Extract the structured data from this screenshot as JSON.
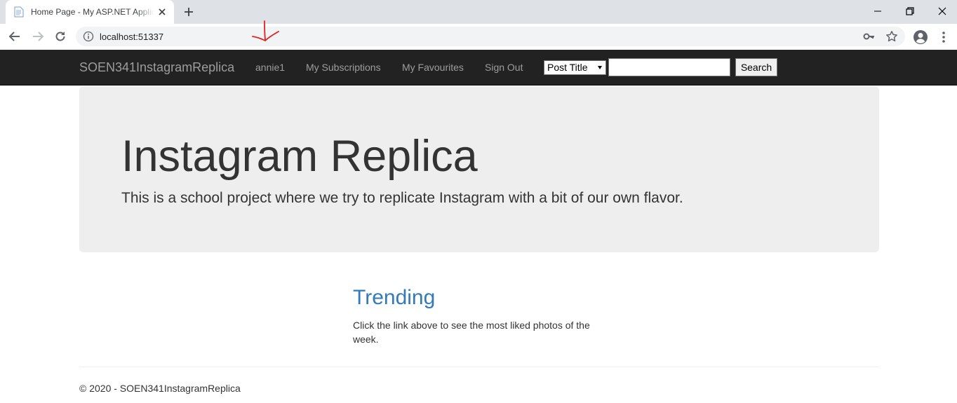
{
  "browser": {
    "tab": {
      "title": "Home Page - My ASP.NET Application"
    },
    "address_bar": {
      "url": "localhost:51337"
    },
    "icons": [
      "document-icon",
      "close-icon",
      "plus-icon",
      "minimize-icon",
      "restore-icon",
      "close-window-icon",
      "back-icon",
      "forward-icon",
      "reload-icon",
      "info-icon",
      "key-icon",
      "star-icon",
      "account-icon",
      "menu-icon",
      "arrow-annotation-icon"
    ]
  },
  "navbar": {
    "brand": "SOEN341InstagramReplica",
    "links": [
      "annie1",
      "My Subscriptions",
      "My Favourites",
      "Sign Out"
    ],
    "search": {
      "select_value": "Post Title",
      "input_value": "",
      "button_label": "Search"
    },
    "colors": {
      "background": "#222222",
      "text": "#9d9d9d"
    }
  },
  "jumbotron": {
    "title": "Instagram Replica",
    "lead": "This is a school project where we try to replicate Instagram with a bit of our own flavor."
  },
  "trending": {
    "title": "Trending",
    "description": "Click the link above to see the most liked photos of the week.",
    "color": "#337ab7"
  },
  "footer": {
    "text": "© 2020 - SOEN341InstagramReplica"
  }
}
